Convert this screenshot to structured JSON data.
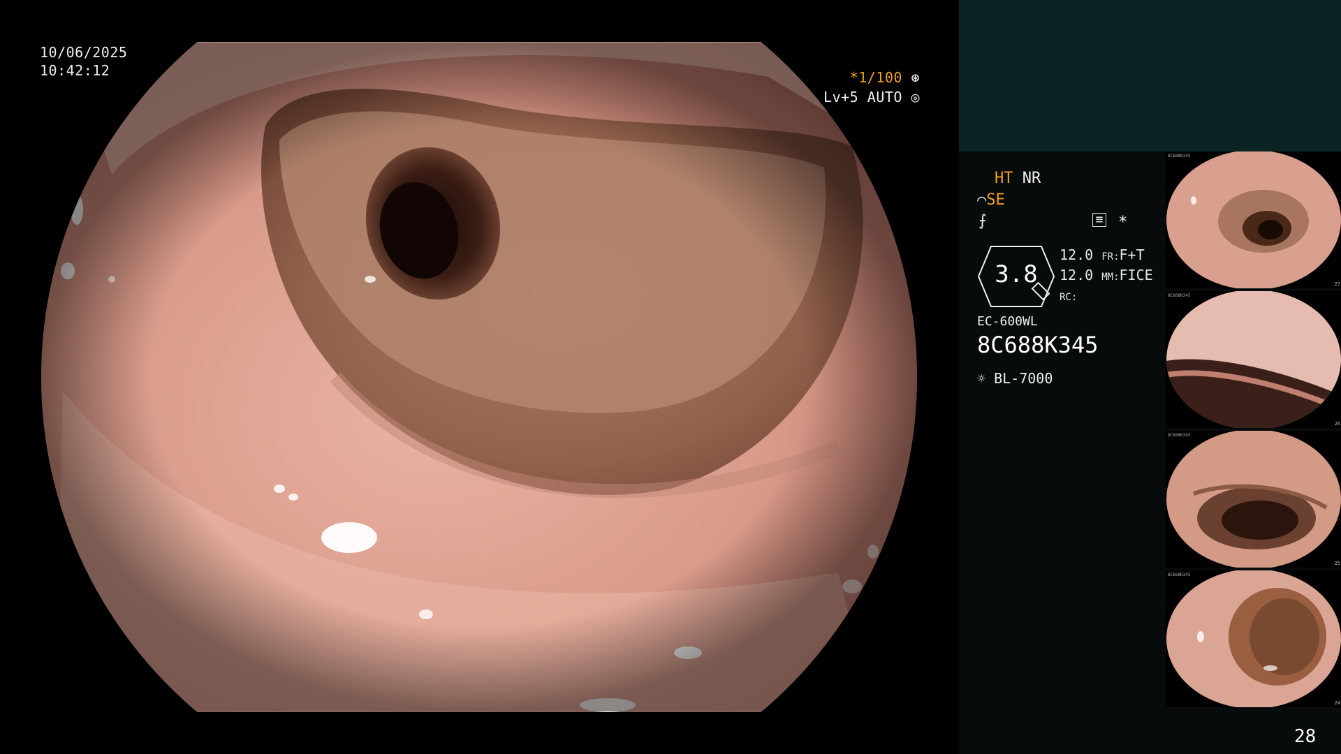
{
  "overlay": {
    "date": "10/06/2025",
    "time": "10:42:12",
    "shutter": "*1/100",
    "shutter_icon": "aperture-icon",
    "iris": "Lv+5 AUTO",
    "iris_icon": "iris-icon"
  },
  "panel": {
    "modes": {
      "ht": "HT",
      "nr": "NR",
      "se": "SE"
    },
    "extra_mark": "*",
    "zoom_value": "3.8",
    "settings": [
      {
        "value": "12.0",
        "key": "FR:",
        "val": "F+T"
      },
      {
        "value": "12.0",
        "key": "MM:",
        "val": "FICE"
      },
      {
        "value": "",
        "key": "RC:",
        "val": ""
      }
    ],
    "scope_model": "EC-600WL",
    "serial": "8C688K345",
    "light_source": "BL-7000",
    "light_icon": "light-source-icon",
    "image_count": "28"
  },
  "thumbnails": [
    {
      "number": "27",
      "serial": "8C688K345"
    },
    {
      "number": "26",
      "serial": "8C688K345"
    },
    {
      "number": "25",
      "serial": "8C688K345"
    },
    {
      "number": "24",
      "serial": "8C688K345"
    }
  ],
  "colors": {
    "panel_bg": "#070b0b",
    "panel_top_bg": "#0b2323",
    "osd_amber": "#f0a020",
    "mucosa": "#d99a8a",
    "lumen": "#2a1510"
  }
}
